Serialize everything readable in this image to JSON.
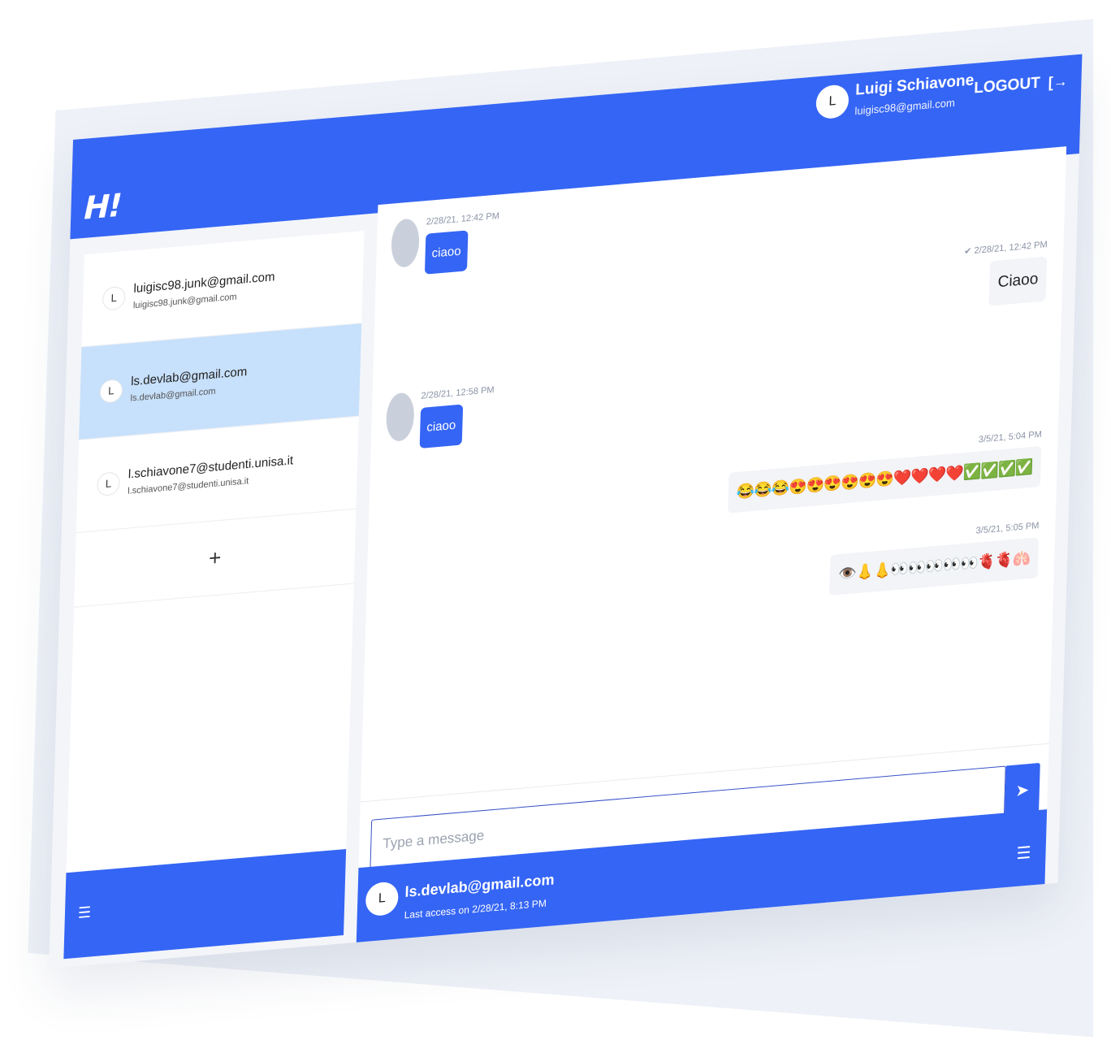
{
  "app": {
    "logo": "H!"
  },
  "header": {
    "user_initial": "L",
    "user_name": "Luigi Schiavone",
    "user_email": "luigisc98@gmail.com",
    "logout_label": "LOGOUT",
    "logout_icon": "[→"
  },
  "contacts": [
    {
      "initial": "L",
      "name": "luigisc98.junk@gmail.com",
      "sub": "luigisc98.junk@gmail.com",
      "active": false
    },
    {
      "initial": "L",
      "name": "ls.devlab@gmail.com",
      "sub": "ls.devlab@gmail.com",
      "active": true
    },
    {
      "initial": "L",
      "name": "l.schiavone7@studenti.unisa.it",
      "sub": "l.schiavone7@studenti.unisa.it",
      "active": false
    }
  ],
  "add_contact_symbol": "+",
  "left_menu_icon": "☰",
  "messages": [
    {
      "direction": "in",
      "time": "2/28/21, 12:42 PM",
      "text": "ciaoo"
    },
    {
      "direction": "out",
      "time": "✔ 2/28/21, 12:42 PM",
      "text": "Ciaoo"
    },
    {
      "direction": "in",
      "time": "2/28/21, 12:58 PM",
      "text": "ciaoo"
    },
    {
      "direction": "out",
      "time": "3/5/21, 5:04 PM",
      "text": "😂😂😂😍😍😍😍😍😍❤️❤️❤️❤️✅✅✅✅"
    },
    {
      "direction": "out",
      "time": "3/5/21, 5:05 PM",
      "text": "👁️👃👃👀👀👀👀👀🫀🫀🫁"
    }
  ],
  "composer": {
    "placeholder": "Type a message",
    "send_icon": "➤"
  },
  "chat_footer": {
    "initial": "L",
    "name": "ls.devlab@gmail.com",
    "last_access": "Last access on 2/28/21, 8:13 PM",
    "menu_icon": "☰"
  }
}
